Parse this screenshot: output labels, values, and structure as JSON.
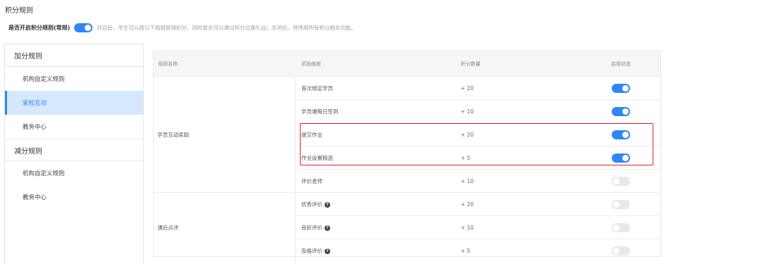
{
  "page": {
    "title": "积分规则",
    "enable_label": "是否开启积分规则(常规)",
    "enable_on": true,
    "enable_hint": "开启后，学生可以按以下规则获得积分，同时家长可以通过积分兑换礼品；关闭后，将停用所有积分相关功能。"
  },
  "sidebar": {
    "groups": [
      {
        "label": "加分规则",
        "items": [
          {
            "label": "机构自定义规则",
            "active": false
          },
          {
            "label": "家校互动",
            "active": true
          },
          {
            "label": "教务中心",
            "active": false
          }
        ]
      },
      {
        "label": "减分规则",
        "items": [
          {
            "label": "机构自定义规则",
            "active": false
          },
          {
            "label": "教务中心",
            "active": false
          }
        ]
      }
    ]
  },
  "table": {
    "headers": {
      "rule_name": "规则名称",
      "reward_dimension": "奖励维度",
      "points": "积分数量",
      "status": "启用状态"
    },
    "groups": [
      {
        "name": "学员互动奖励",
        "rows": [
          {
            "reward": "首次绑定学员",
            "points": "+ 20",
            "enabled": true,
            "info": false
          },
          {
            "reward": "学员端每日签到",
            "points": "+ 10",
            "enabled": true,
            "info": false
          },
          {
            "reward": "提交作业",
            "points": "+ 20",
            "enabled": true,
            "info": false
          },
          {
            "reward": "作业设置精选",
            "points": "+ 5",
            "enabled": true,
            "info": false
          },
          {
            "reward": "评价老师",
            "points": "+ 10",
            "enabled": false,
            "info": false
          }
        ]
      },
      {
        "name": "课后点评",
        "rows": [
          {
            "reward": "优秀评价",
            "points": "+ 20",
            "enabled": false,
            "info": true
          },
          {
            "reward": "良好评价",
            "points": "+ 10",
            "enabled": false,
            "info": true
          },
          {
            "reward": "及格评价",
            "points": "+ 5",
            "enabled": false,
            "info": true
          }
        ]
      }
    ]
  },
  "colors": {
    "accent": "#2f86f6",
    "active_bg": "#d6e8fb",
    "highlight": "#e02424",
    "toggle_off": "#e6e8ec"
  },
  "icons": {
    "info": "question-circle-icon"
  }
}
